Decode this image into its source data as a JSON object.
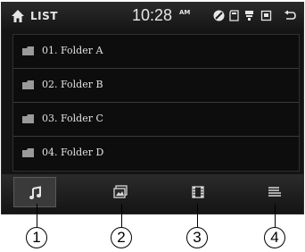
{
  "header": {
    "title": "LIST",
    "time": "10:28",
    "ampm": "AM",
    "status_icons": [
      "disc-icon",
      "sd-card-icon",
      "usb-icon",
      "bluetooth-icon"
    ]
  },
  "list": {
    "items": [
      {
        "label": "01. Folder A"
      },
      {
        "label": "02. Folder B"
      },
      {
        "label": "03. Folder C"
      },
      {
        "label": "04. Folder D"
      }
    ]
  },
  "tabs": [
    {
      "name": "music",
      "icon": "music-note-icon",
      "active": true
    },
    {
      "name": "photo",
      "icon": "picture-icon",
      "active": false
    },
    {
      "name": "video",
      "icon": "film-icon",
      "active": false
    },
    {
      "name": "list",
      "icon": "list-icon",
      "active": false
    }
  ],
  "callouts": [
    "1",
    "2",
    "3",
    "4"
  ],
  "colors": {
    "background": "#141414",
    "text": "#e6e6e6",
    "active_tab": "#3a3a3a"
  }
}
